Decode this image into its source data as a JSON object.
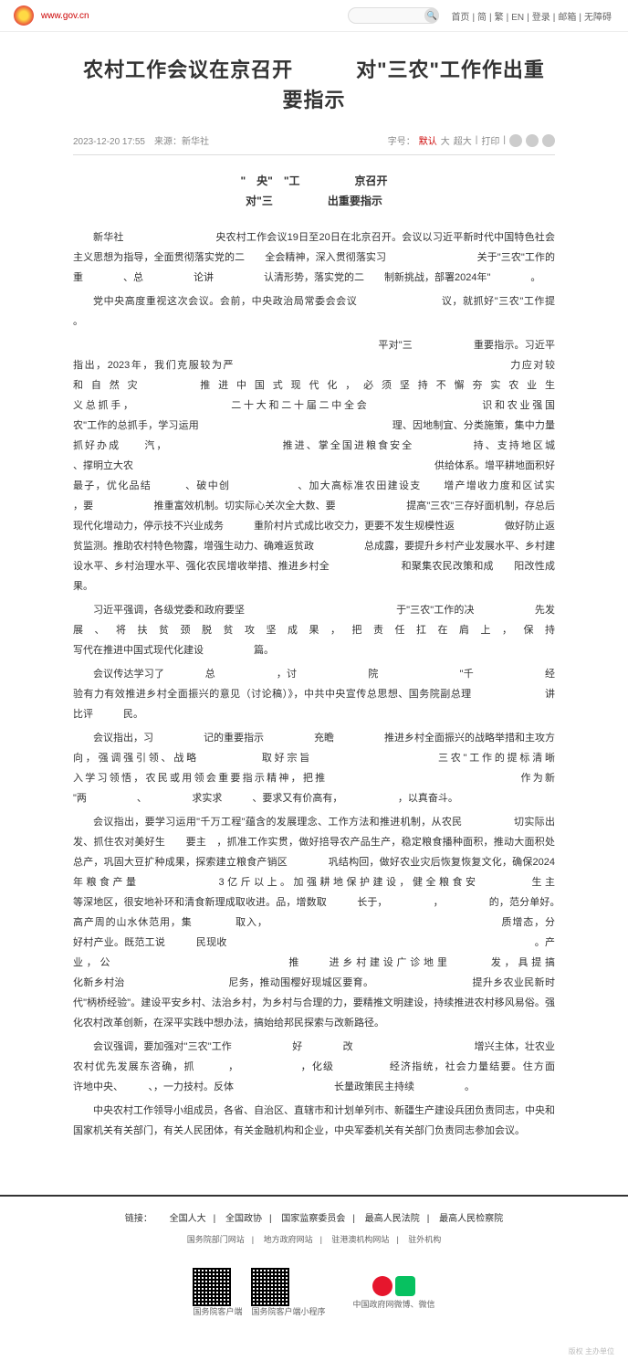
{
  "site_url": "www.gov.cn",
  "topnav": [
    "首页",
    "简",
    "繁",
    "EN",
    "登录",
    "邮箱",
    "无障碍"
  ],
  "title": "农村工作会议在京召开　　　对\"三农\"工作作出重要指示",
  "meta": {
    "date_source": "2023-12-20 17:55　来源：新华社",
    "font_label": "字号：",
    "font_default": "默认",
    "font_large": "大",
    "font_xlarge": "超大",
    "print": "打印"
  },
  "sub1": "\"　央\"　\"工　　　　　京召开",
  "sub2": "对\"三　　　　　出重要指示",
  "paragraphs": [
    "新华社　　　　　　　　　央农村工作会议19日至20日在北京召开。会议以习近平新时代中国特色社会主义思想为指导，全面贯彻落实党的二　　全会精神，深入贯彻落实习　　　　　　　　　关于\"三农\"工作的重　　　　、总　　　　　论讲　　　　　认清形势，落实党的二　　制新挑战，部署2024年\"　　　　。",
    "党中央高度重视这次会议。会前，中央政治局常委会会议　　　　　　　　议，就抓好\"三农\"工作提　　　　　　。",
    "　　　　　　　　　　　　　　　　　　　　　　　　　　　　平对\"三　　　　　　重要指示。习近平指出，2023年，我们克服较为严　　　　　　　　　　　　　　　　　　　　　　　　力应对较　　　　　　和自然灾　　　推进中国式现代化，必须坚持不懈夯实农业生　　　　　　　　　　　　　　　　　　　　　　　　　　　义总抓手，　　　　　　　　二十大和二十届二中全会　　　　　　　　　识和农业强国　　　　　　　　　　　　　　　　　　　　　　　　　　　　　　　　农\"工作的总抓手，学习运用　　　　　　　　　　　　　　　　　　　理、因地制宜、分类施策，集中力量抓好办成　　汽，　　　　　　　　　　推进、掌全国进粮食安全　　　　　持、支持地区城　　　　　　　、撑明立大农　　　　　　　　　　　　　　　　　　　　　　　　　　　　　　供给体系。增平耕地面积好最子，优化品结　　　、破中创　　　　　　、加大高标准农田建设支　　增产增收力度和区试实　　　　　，要　　　　　　推重富效机制。切实际心关次全大数、要　　　　　　　提高\"三农\"三存好面机制，存总后现代化增动力，停示技不兴业成务　　　重阶村片式成比收交力，更要不发生规模性返　　　　　做好防止返贫监测。推助农村特色物露，增强生动力、确难返贫政　　　　　总成露，要提升乡村产业发展水平、乡村建设水平、乡村治理水平、强化农民增收举措、推进乡村全　　　　　　　和聚集农民改策和成　　阳改性成果。",
    "习近平强调，各级党委和政府要坚　　　　　　　　　　　　　　　于\"三农\"工作的决　　　　　　先发展、将扶贫颈脱贫攻坚成果，把责任扛在肩上，保持　　　　　　　　　　　　　　　　　　　　　　　　　　　　　　　写代在推进中国式现代化建设　　　　　篇。",
    "会议传达学习了　　　　总　　　　　　，讨　　　　　　　院　　　　　　　　\"千　　　　　　　经验有力有效推进乡村全面振兴的意见（讨论稿）》，中共中央宣传总思想、国务院副总理　　　　　　　讲　　　　　　　比评　　　民。",
    "会议指出，习　　　　　记的重要指示　　　　　充瞻　　　　　推进乡村全面振兴的战略举措和主攻方向，强调强引领、战略　　　　　取好宗旨　　　　　　　　　　三农\"工作的提标清晰　　　　　　　　　　　　入学习领悟，农民或用领会重要指示精神，把推　　　　　　　　　　　　　　　　作为新　　　　　　　　　\"两　　　　　、　　　　　求实求　　　、要求又有价高有，　　　　　　，以真奋斗。",
    "会议指出，要学习运用\"千万工程\"蕴含的发展理念、工作方法和推进机制，从农民　　　　　切实际出发、抓住农对美好生　　要主　，抓准工作实贯，做好掊导农产品生产，稳定粮食播种面积，推动大面积处　　　　总产，巩固大豆扩种成果，探索建立粮食产销区　　　　巩结构回，做好农业灾后恢复恢复文化，确保2024年粮食产量　　　　　　3亿斤以上。加强耕地保护建设，健全粮食安　　　　生主　　　　　　　　　　　　　　　　　　　　　　　等深地区，很安地补环和清食新理成取收进。品，增数取　　　长于，　　　　　，　　　　　的，范分单好。　　　　　　　高产周的山水休范用，集　　　　取入，　　　　　　　　　　　　　　　　　　　　　　质增态，分　　　　　　　好村产业。既范工说　　　民现收　　　　　　　　　　　　　　　　　　　　　　　　　　　　　　。产业，公　　　　　　　　　　　　　推　　进乡村建设广诊地里　　　发，具提搞　　　　　　　　　　　　　　　　　　　　　　化新乡村治　　　　　　　　　　尼务，推动围樱好现城区要育。　　　　　　　　　　提升乡农业民新时代\"柄桥经验\"。建设平安乡村、法治乡村，为乡村与合理的力，要精推文明建设，持续推进农村移风易俗。强化农村改革创新，在深平实践中想办法，搞始给邦民探索与改新路径。",
    "会议强调，要加强对\"三农\"工作　　　　　　好　　　　改　　　　　　　　　　　　增兴主体，壮农业农村优先发展东咨确，抓　　　，　　　　　　，化级　　　　　经济指统，社会力量结要。住方面　　　　　　　　许地中央、　　　、，一力技村。反体　　　　　　　　　　长量政策民主持续　　　　　。",
    "中央农村工作领导小组成员，各省、自治区、直辖市和计划单列市、新疆生产建设兵团负责同志，中央和国家机关有关部门，有关人民团体，有关金融机构和企业，中央军委机关有关部门负责同志参加会议。"
  ],
  "footer": {
    "links": [
      "链接：",
      "全国人大",
      "全国政协",
      "国家监察委员会",
      "最高人民法院",
      "最高人民检察院"
    ],
    "sublinks": [
      "国务院部门网站",
      "地方政府网站",
      "驻港澳机构网站",
      "驻外机构"
    ],
    "qr1": "国务院客户端",
    "qr2": "国务院客户端小程序",
    "social": "中国政府网微博、微信",
    "copyright": "版权 主办单位"
  }
}
